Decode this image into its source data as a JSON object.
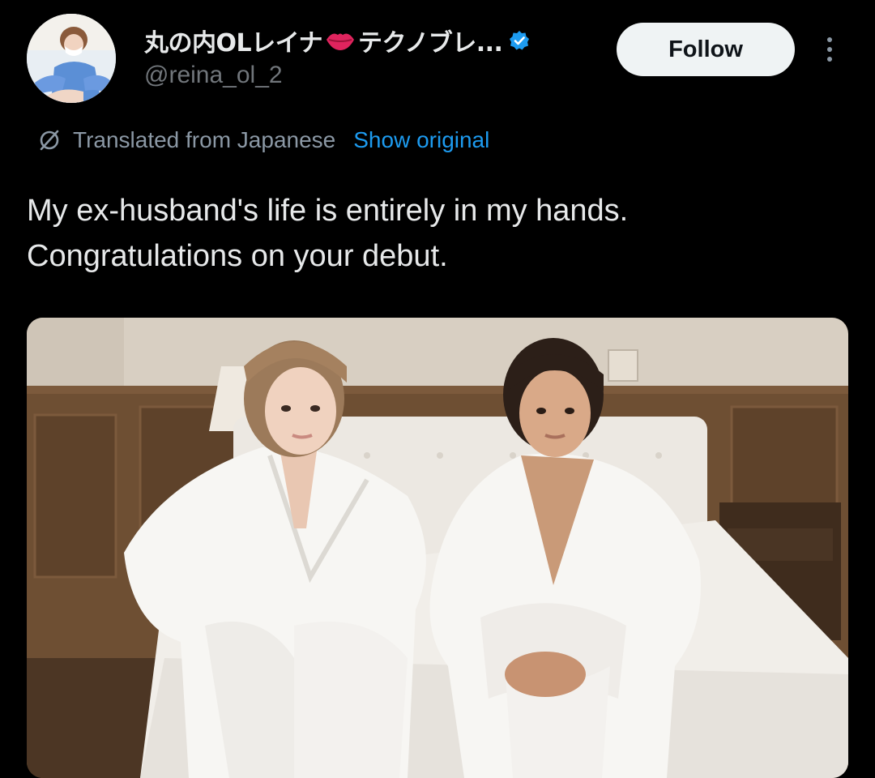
{
  "author": {
    "display_name": "丸の内OLレイナ",
    "display_name_suffix": "テクノブレ...",
    "handle": "@reina_ol_2",
    "verified": true,
    "avatar_icon": "avatar-photo",
    "emoji_icon": "lips-icon"
  },
  "actions": {
    "follow_label": "Follow",
    "more_icon": "more-dots-icon"
  },
  "translation": {
    "icon": "translate-icon",
    "label": "Translated from Japanese",
    "show_original_label": "Show original"
  },
  "tweet": {
    "lines": [
      "My ex-husband's life is entirely in my hands.",
      "Congratulations on your debut."
    ]
  },
  "media": {
    "type": "photo",
    "alt": ""
  },
  "colors": {
    "background": "#000000",
    "text_primary": "#e7e9ea",
    "text_secondary": "#71767b",
    "link": "#1d9bf0",
    "follow_bg": "#eff3f4",
    "verified": "#1d9bf0",
    "lips": "#e0245e"
  }
}
